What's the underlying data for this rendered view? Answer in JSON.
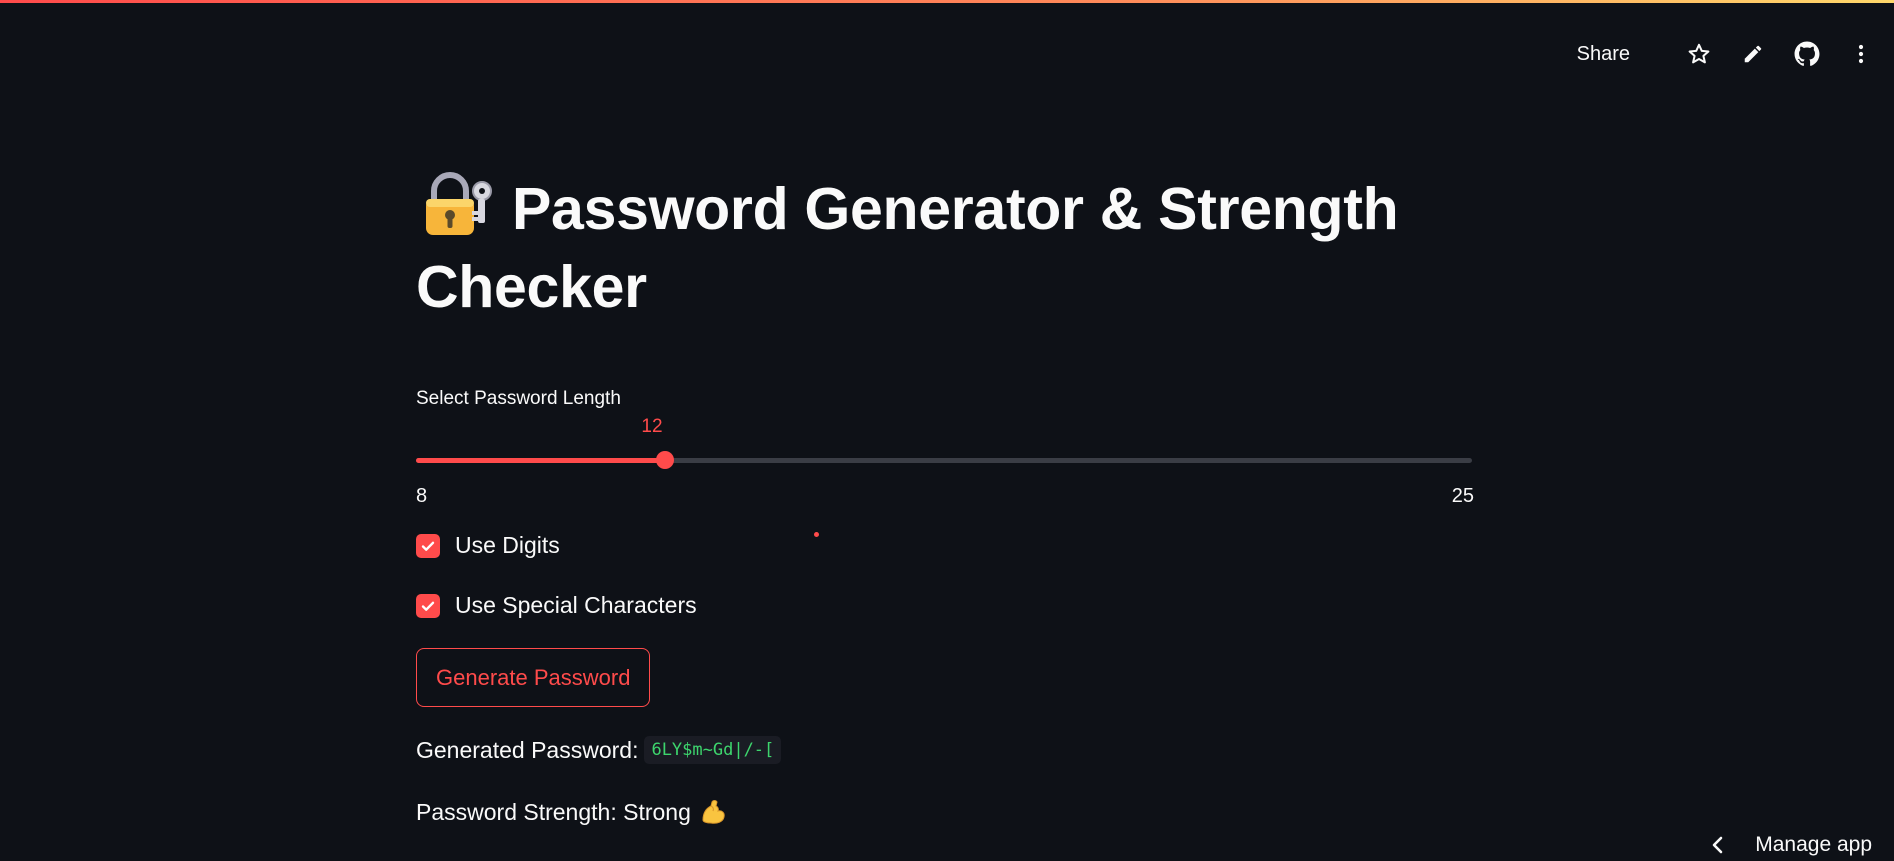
{
  "header": {
    "share_label": "Share",
    "icons": [
      "star-icon",
      "pencil-icon",
      "github-icon",
      "more-vertical-icon"
    ]
  },
  "app": {
    "title_emoji": "locked-with-key-emoji",
    "title": "Password Generator & Strength Checker"
  },
  "slider": {
    "label": "Select Password Length",
    "value": "12",
    "min": "8",
    "max": "25"
  },
  "options": {
    "digits_label": "Use Digits",
    "digits_checked": true,
    "special_label": "Use Special Characters",
    "special_checked": true
  },
  "actions": {
    "generate_label": "Generate Password"
  },
  "result": {
    "password_label": "Generated Password:",
    "password_value": "6LY$m~Gd|/-[",
    "strength_text": "Password Strength: Strong",
    "strength_emoji": "flexed-biceps-emoji"
  },
  "footer": {
    "manage_label": "Manage app"
  },
  "colors": {
    "background": "#0e1117",
    "accent": "#ff4b4b",
    "code_text": "#3dd56d",
    "text": "#fafafa"
  }
}
